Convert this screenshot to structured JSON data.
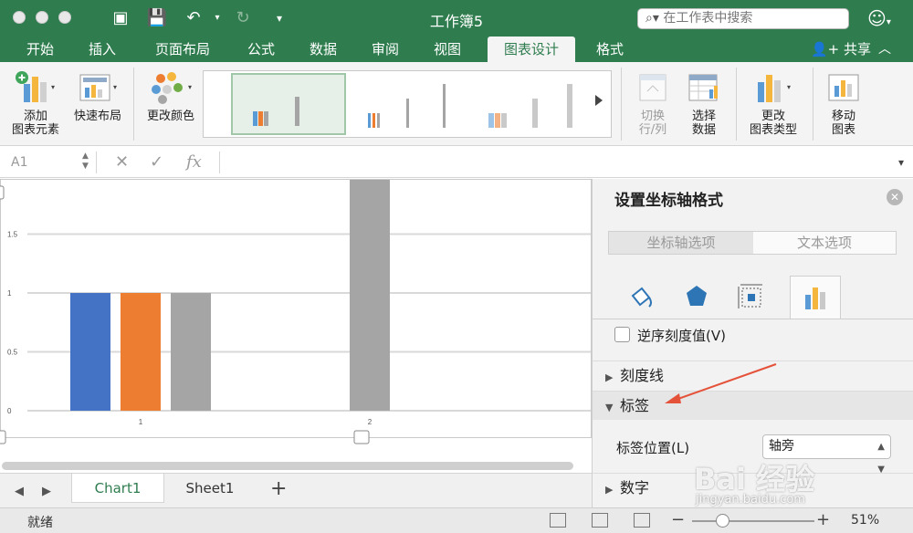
{
  "window": {
    "title": "工作簿5",
    "search_placeholder": "在工作表中搜索"
  },
  "tabs": [
    {
      "label": "开始"
    },
    {
      "label": "插入"
    },
    {
      "label": "页面布局"
    },
    {
      "label": "公式"
    },
    {
      "label": "数据"
    },
    {
      "label": "审阅"
    },
    {
      "label": "视图"
    },
    {
      "label": "图表设计",
      "active": true
    },
    {
      "label": "格式"
    }
  ],
  "share_label": "共享",
  "ribbon": {
    "add_element": {
      "line1": "添加",
      "line2": "图表元素"
    },
    "quick_layout": "快速布局",
    "change_colors": "更改颜色",
    "switch_rowcol": {
      "line1": "切换",
      "line2": "行/列",
      "disabled": true
    },
    "select_data": {
      "line1": "选择",
      "line2": "数据"
    },
    "change_type": {
      "line1": "更改",
      "line2": "图表类型"
    },
    "move_chart": {
      "line1": "移动",
      "line2": "图表"
    }
  },
  "formula_bar": {
    "name_box": "A1",
    "fx": "fx"
  },
  "chart_data": {
    "type": "bar",
    "categories": [
      "1",
      "2"
    ],
    "series": [
      {
        "values": [
          1,
          null
        ],
        "color": "#4472c4"
      },
      {
        "values": [
          1,
          null
        ],
        "color": "#ed7d31"
      },
      {
        "values": [
          1,
          2
        ],
        "color": "#a5a5a5"
      }
    ],
    "y_ticks": [
      "0",
      "0.5",
      "1",
      "1.5"
    ],
    "ylim": [
      0,
      2
    ],
    "grid": true
  },
  "sheet_tabs": [
    {
      "label": "Chart1",
      "active": true
    },
    {
      "label": "Sheet1",
      "active": false
    }
  ],
  "status": {
    "text": "就绪",
    "zoom": "51%"
  },
  "pane": {
    "title": "设置坐标轴格式",
    "seg_axis": "坐标轴选项",
    "seg_text": "文本选项",
    "reverse_label": "逆序刻度值(V)",
    "section_ticks": "刻度线",
    "section_labels": "标签",
    "label_position_label": "标签位置(L)",
    "label_position_value": "轴旁",
    "section_number": "数字"
  },
  "watermark": {
    "main": "Bai 经验",
    "sub": "jingyan.baidu.com"
  },
  "colors": {
    "accent": "#2f7d4f",
    "series1": "#4472c4",
    "series2": "#ed7d31",
    "series3": "#a5a5a5",
    "annotation": "#e5523a"
  }
}
